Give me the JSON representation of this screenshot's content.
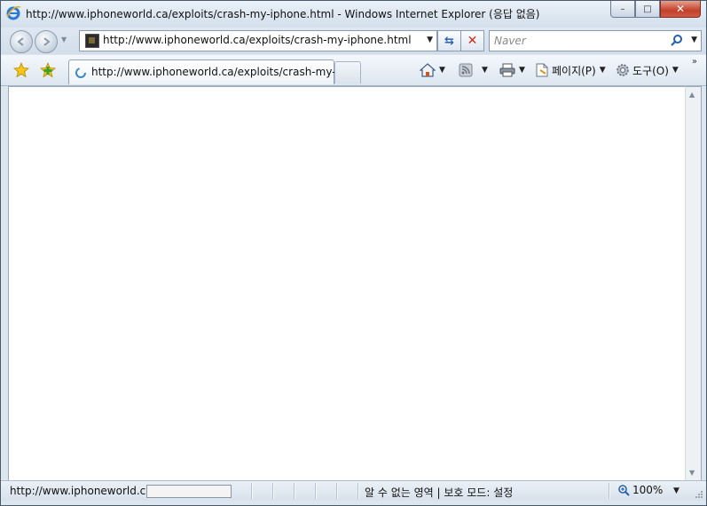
{
  "window": {
    "title": "http://www.iphoneworld.ca/exploits/crash-my-iphone.html - Windows Internet Explorer (응답 없음)",
    "buttons": {
      "minimize": "–",
      "maximize": "□",
      "close": "✕"
    }
  },
  "navigation": {
    "back_icon": "back-arrow-icon",
    "forward_icon": "forward-arrow-icon",
    "address": "http://www.iphoneworld.ca/exploits/crash-my-iphone.html",
    "refresh_icon": "refresh-icon",
    "stop_icon": "stop-icon",
    "search_placeholder": "Naver"
  },
  "tabs": [
    {
      "title": "http://www.iphoneworld.ca/exploits/crash-my-i...",
      "state": "loading"
    }
  ],
  "command_bar": {
    "home_icon": "home-icon",
    "feeds_icon": "rss-icon",
    "print_icon": "printer-icon",
    "page_label": "페이지(P)",
    "tools_label": "도구(O)",
    "overflow": "»"
  },
  "status_bar": {
    "url": "http://www.iphoneworld.ca/",
    "progress": 0.0,
    "zone": "알 수 없는 영역 | 보호 모드: 설정",
    "zoom": "100%"
  },
  "colors": {
    "chrome": "#dde6ef",
    "close_button": "#c3402a",
    "content": "#ffffff"
  }
}
